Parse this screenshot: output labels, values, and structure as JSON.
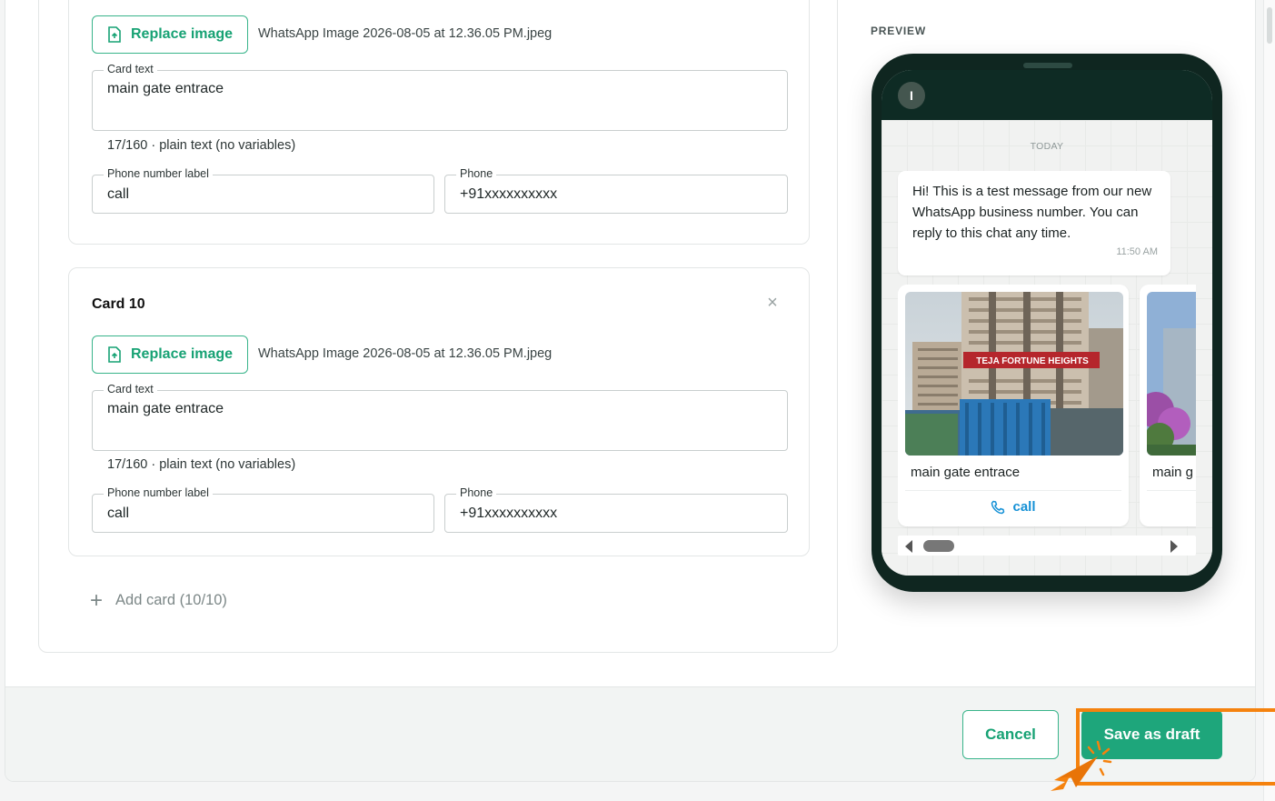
{
  "cards": {
    "replace_image_label": "Replace image",
    "file_name": "WhatsApp Image 2026-08-05 at 12.36.05 PM.jpeg",
    "card_text_label": "Card text",
    "card_text_value": "main gate entrace",
    "char_count": "17/160 · plain text (no variables)",
    "phone_label_label": "Phone number label",
    "phone_label_value": "call",
    "phone_field_label": "Phone",
    "phone_value": "+91xxxxxxxxxx",
    "card10_title": "Card 10",
    "close_glyph": "×"
  },
  "add_card": {
    "plus": "+",
    "label": "Add card (10/10)"
  },
  "preview": {
    "label": "PREVIEW",
    "avatar_initial": "I",
    "today": "TODAY",
    "message": "Hi! This is a test message from our new WhatsApp business number. You can reply to this chat any time.",
    "time": "11:50 AM",
    "carousel_caption": "main gate entrace",
    "carousel_caption_2": "main g",
    "call_label": "call",
    "building_sign": "TEJA FORTUNE HEIGHTS"
  },
  "footer": {
    "cancel_label": "Cancel",
    "save_label": "Save as draft"
  },
  "colors": {
    "brand_green": "#1ea67b",
    "link_blue": "#1591d6",
    "highlight_orange": "#f5820e",
    "header_dark": "#0e2b24"
  }
}
